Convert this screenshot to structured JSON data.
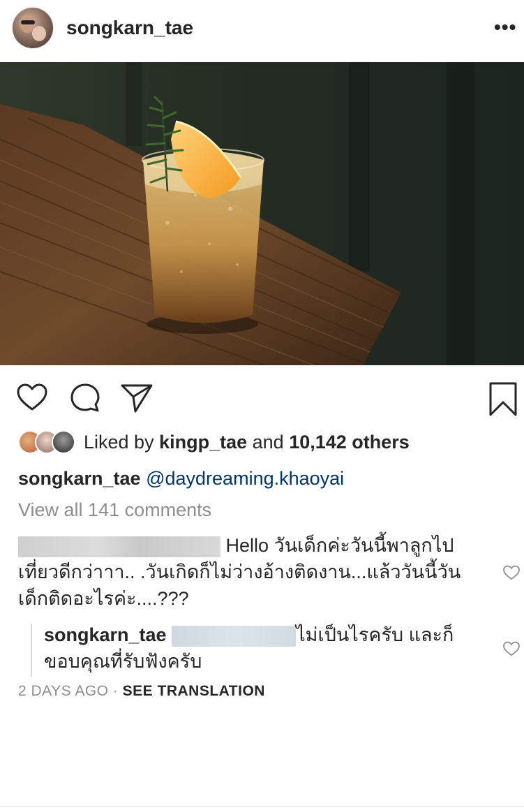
{
  "post": {
    "username": "songkarn_tae",
    "more_label": "•••"
  },
  "photo": {
    "subject": "cocktail glass with orange slice and rosemary on wooden table"
  },
  "icons": {
    "like": "heart-icon",
    "comment": "comment-icon",
    "share": "paper-plane-icon",
    "save": "bookmark-icon"
  },
  "likes": {
    "prefix": "Liked by ",
    "user": "kingp_tae",
    "middle": " and ",
    "count": "10,142 others"
  },
  "caption": {
    "username": "songkarn_tae",
    "mention": "@daydreaming.khaoyai"
  },
  "view_all": "View all 141 comments",
  "comments": [
    {
      "text_line1": " Hello วันเด็กค่ะวันนี้พาลูกไป",
      "text_rest": "เที่ยวดีกว่าาา.. .วันเกิดก็ไม่ว่างอ้างติดงาน...แล้ววันนี้วันเด็กติดอะไรค่ะ....???"
    }
  ],
  "reply": {
    "username": "songkarn_tae",
    "text": "ไม่เป็นไรครับ และก็ขอบคุณที่รับฟังครับ"
  },
  "meta": {
    "time": "2 DAYS AGO",
    "separator": " · ",
    "translate": "SEE TRANSLATION"
  },
  "colors": {
    "text": "#262626",
    "muted": "#8e8e8e",
    "link": "#003569"
  }
}
